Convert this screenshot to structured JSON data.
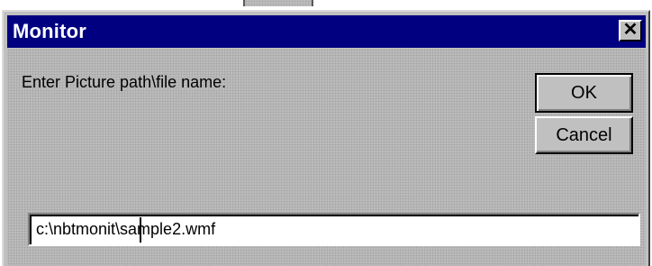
{
  "window": {
    "title": "Monitor",
    "close_glyph": "✕"
  },
  "dialog": {
    "prompt_label": "Enter Picture path\\file name:",
    "path_value": "c:\\nbtmonit\\sample2.wmf"
  },
  "buttons": {
    "ok_label": "OK",
    "cancel_label": "Cancel"
  },
  "icons": {
    "close": "close-icon"
  },
  "colors": {
    "titlebar": "#000080",
    "face": "#c0c0c0",
    "title_text": "#ffffff"
  }
}
